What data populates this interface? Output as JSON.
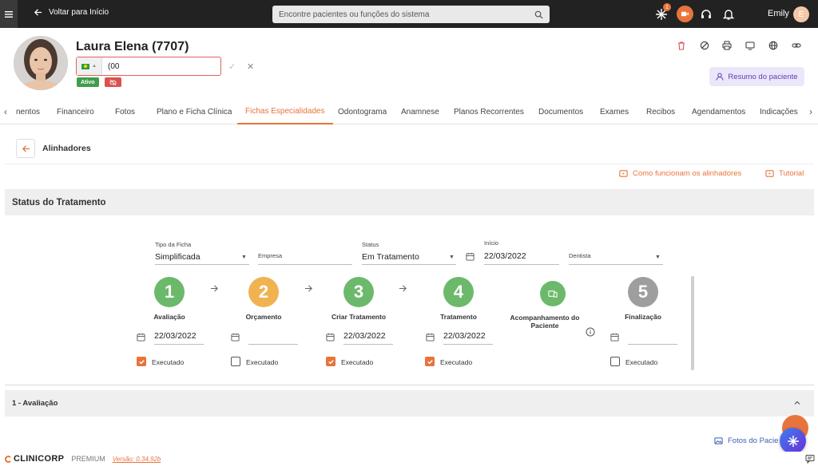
{
  "topbar": {
    "back_label": "Voltar para Início",
    "search_placeholder": "Encontre pacientes ou funções do sistema",
    "notification_count": "1",
    "user_name": "Emily",
    "user_initial": "E"
  },
  "patient": {
    "name": "Laura Elena (7707)",
    "phone_value": "(00",
    "status_badge": "Ativo",
    "summary_button": "Resumo do paciente"
  },
  "tabs": [
    "nentos",
    "Financeiro",
    "Fotos",
    "Plano e Ficha Clínica",
    "Fichas Especialidades",
    "Odontograma",
    "Anamnese",
    "Planos Recorrentes",
    "Documentos",
    "Exames",
    "Recibos",
    "Agendamentos",
    "Indicações"
  ],
  "active_tab": "Fichas Especialidades",
  "section": {
    "title": "Alinhadores",
    "how_it_works_link": "Como funcionam os alinhadores",
    "tutorial_link": "Tutorial",
    "status_panel_title": "Status do Tratamento",
    "evaluation_panel_title": "1 - Avaliação",
    "photos_link": "Fotos do Pacie"
  },
  "form": {
    "tipo_label": "Tipo da Ficha",
    "tipo_value": "Simplificada",
    "empresa_label": "Empresa",
    "status_label": "Status",
    "status_value": "Em Tratamento",
    "inicio_label": "Início",
    "inicio_value": "22/03/2022",
    "dentista_label": "Dentista"
  },
  "steps": [
    {
      "number": "1",
      "label": "Avaliação",
      "date": "22/03/2022",
      "executed": true,
      "color": "#6cb96c"
    },
    {
      "number": "2",
      "label": "Orçamento",
      "date": "",
      "executed": false,
      "color": "#f1b252"
    },
    {
      "number": "3",
      "label": "Criar Tratamento",
      "date": "22/03/2022",
      "executed": true,
      "color": "#6cb96c"
    },
    {
      "number": "4",
      "label": "Tratamento",
      "date": "22/03/2022",
      "executed": true,
      "color": "#6cb96c"
    },
    {
      "number": "",
      "label": "Acompanhamento do Paciente",
      "date": "",
      "executed": false,
      "color": "#6cb96c"
    },
    {
      "number": "5",
      "label": "Finalização",
      "date": "",
      "executed": false,
      "color": "#9e9e9e"
    }
  ],
  "executed_label": "Executado",
  "footer": {
    "brand": "CLINICORP",
    "plan": "PREMIUM",
    "version": "Versão: 0.34.92b"
  },
  "colors": {
    "accent": "#e8743b",
    "topbar": "#222222",
    "success": "#6cb96c",
    "warning": "#f1b252",
    "neutral": "#9e9e9e",
    "danger": "#d9534f"
  }
}
